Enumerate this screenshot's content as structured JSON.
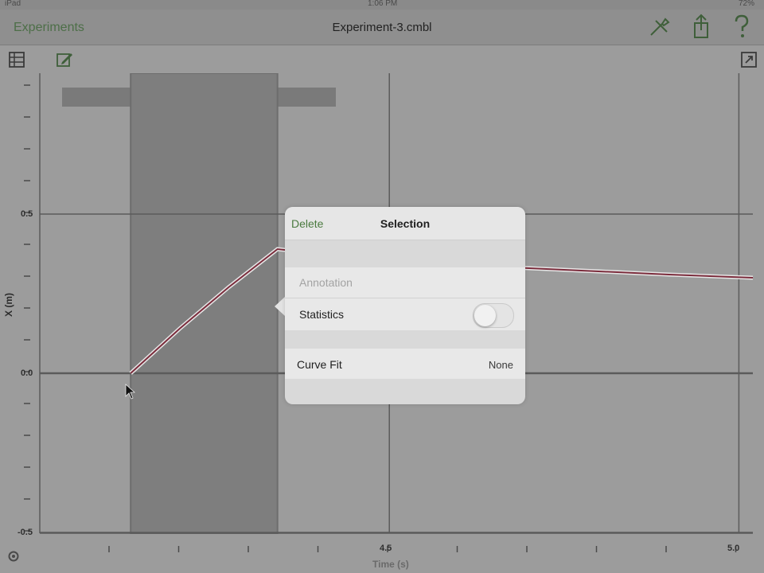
{
  "status_bar": {
    "device": "iPad",
    "time": "1:06 PM",
    "battery": "72%"
  },
  "nav": {
    "back_label": "Experiments",
    "title": "Experiment-3.cmbl",
    "icons": [
      "tools-icon",
      "share-icon",
      "help-icon"
    ]
  },
  "toolbar": {
    "icons": [
      "table-icon",
      "edit-icon",
      "expand-icon"
    ]
  },
  "graph": {
    "y_axis_label": "X (m)",
    "x_axis_label": "Time (s)",
    "y_ticks": [
      "0.5",
      "0.0",
      "-0.5"
    ],
    "x_ticks": [
      "4.5",
      "5.0"
    ],
    "line_color": "#7b2c3c",
    "selection_color": "#7e7e7e"
  },
  "popover": {
    "delete_label": "Delete",
    "title": "Selection",
    "annotation_placeholder": "Annotation",
    "statistics_label": "Statistics",
    "statistics_on": false,
    "curve_fit_label": "Curve Fit",
    "curve_fit_value": "None"
  },
  "chart_data": {
    "type": "line",
    "title": "",
    "xlabel": "Time (s)",
    "ylabel": "X (m)",
    "xlim": [
      4.0,
      5.02
    ],
    "ylim": [
      -0.5,
      0.9
    ],
    "x_tick_labels": [
      "4.5",
      "5.0"
    ],
    "y_tick_labels": [
      "0.5",
      "0.0",
      "-0.5"
    ],
    "grid": true,
    "selection_range": [
      4.13,
      4.34
    ],
    "series": [
      {
        "x": [
          4.13,
          4.2,
          4.27,
          4.34,
          4.5,
          4.7,
          4.9,
          5.02
        ],
        "y": [
          0.0,
          0.14,
          0.27,
          0.39,
          0.35,
          0.33,
          0.31,
          0.3
        ]
      }
    ]
  }
}
